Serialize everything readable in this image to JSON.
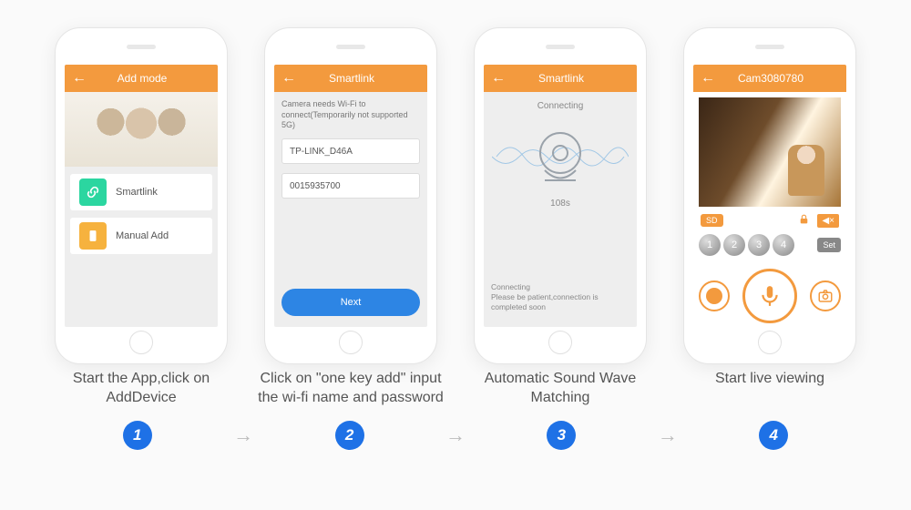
{
  "steps": {
    "s1": {
      "title": "Add mode",
      "smartlink_label": "Smartlink",
      "manual_label": "Manual Add",
      "caption": "Start the App,click on AddDevice"
    },
    "s2": {
      "title": "Smartlink",
      "note": "Camera needs Wi-Fi to connect(Temporarily not supported 5G)",
      "wifi_name": "TP-LINK_D46A",
      "wifi_password": "0015935700",
      "next_label": "Next",
      "caption": "Click on \"one key add\" input the wi-fi name and password"
    },
    "s3": {
      "title": "Smartlink",
      "status_top": "Connecting",
      "timer": "108s",
      "status_msg_1": "Connecting",
      "status_msg_2": "Please be patient,connection is completed soon",
      "caption": "Automatic Sound Wave Matching"
    },
    "s4": {
      "title": "Cam3080780",
      "sd_label": "SD",
      "mute_glyph": "◀×",
      "presets": [
        "1",
        "2",
        "3",
        "4"
      ],
      "set_label": "Set",
      "caption": "Start live viewing"
    }
  },
  "numbers": [
    "1",
    "2",
    "3",
    "4"
  ],
  "arrow_glyph": "→"
}
